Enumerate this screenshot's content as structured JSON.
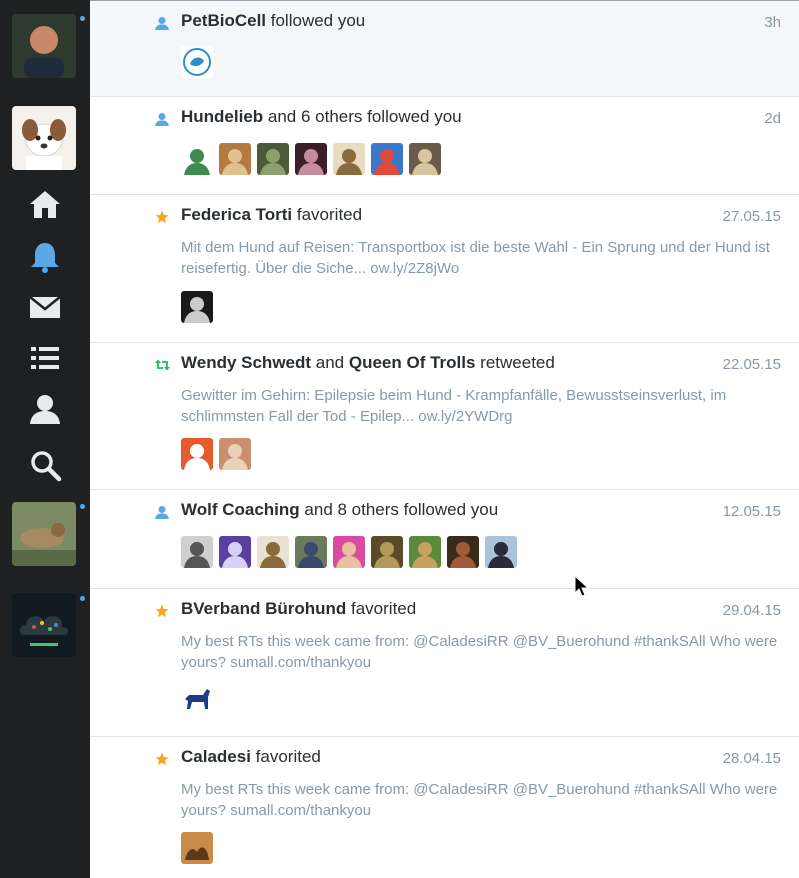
{
  "sidebar": {
    "accounts": [
      {
        "name": "account-avatar-1",
        "colors": [
          "#3b4a3a",
          "#c9876a"
        ]
      },
      {
        "name": "account-avatar-2",
        "colors": [
          "#f2efe9",
          "#8a5a3a"
        ]
      },
      {
        "name": "account-avatar-3",
        "colors": [
          "#6f7d5c",
          "#a58a63"
        ]
      },
      {
        "name": "account-avatar-4",
        "colors": [
          "#0f1a1f",
          "#d94a6c"
        ]
      }
    ],
    "nav": [
      "home-icon",
      "notifications-bell-icon",
      "messages-envelope-icon",
      "lists-icon",
      "profile-icon",
      "search-icon"
    ],
    "active_nav": "notifications-bell-icon",
    "accent": "#5aa7e6"
  },
  "notifications": [
    {
      "type": "follow",
      "actor": "PetBioCell",
      "action": " followed you",
      "time": "3h",
      "avatars": [
        {
          "bg": "#ffffff",
          "fg": "#2d8fc9"
        }
      ]
    },
    {
      "type": "follow",
      "actor": "Hundelieb",
      "action": " and 6 others followed you",
      "time": "2d",
      "avatars": [
        {
          "bg": "#ffffff",
          "fg": "#3f8a50"
        },
        {
          "bg": "#b47a3f",
          "fg": "#e2c08d"
        },
        {
          "bg": "#4a5a3a",
          "fg": "#8ba06a"
        },
        {
          "bg": "#3a1f2a",
          "fg": "#c58ca0"
        },
        {
          "bg": "#e7dbc0",
          "fg": "#8a6a3a"
        },
        {
          "bg": "#3c77c9",
          "fg": "#e04a3a"
        },
        {
          "bg": "#6a5a4a",
          "fg": "#d9c4a0"
        }
      ]
    },
    {
      "type": "favorite",
      "actor": "Federica Torti",
      "action": " favorited",
      "time": "27.05.15",
      "text": "Mit dem Hund auf Reisen: Transportbox ist die beste Wahl - Ein Sprung und der Hund ist reisefertig. Über die Siche... ow.ly/2Z8jWo",
      "avatars": [
        {
          "bg": "#1a1a1a",
          "fg": "#cccccc"
        }
      ]
    },
    {
      "type": "retweet",
      "actor": "Wendy Schwedt",
      "connector": " and ",
      "actor2": "Queen Of Trolls",
      "action": " retweeted",
      "time": "22.05.15",
      "text": "Gewitter im Gehirn: Epilepsie beim Hund - Krampfanfälle, Bewusstseinsverlust, im schlimmsten Fall der Tod - Epilep... ow.ly/2YWDrg",
      "avatars": [
        {
          "bg": "#e55b2e",
          "fg": "#ffffff"
        },
        {
          "bg": "#c99070",
          "fg": "#e9d2b8"
        }
      ]
    },
    {
      "type": "follow",
      "actor": "Wolf Coaching",
      "action": " and 8 others followed you",
      "time": "12.05.15",
      "avatars": [
        {
          "bg": "#cfcfcf",
          "fg": "#555555"
        },
        {
          "bg": "#5a3fa3",
          "fg": "#d9d0f5"
        },
        {
          "bg": "#e9e2d0",
          "fg": "#8a6a3a"
        },
        {
          "bg": "#6a7a5a",
          "fg": "#3a4a6a"
        },
        {
          "bg": "#d94aa0",
          "fg": "#e9c0a0"
        },
        {
          "bg": "#5a4a2a",
          "fg": "#b39a5a"
        },
        {
          "bg": "#5a8a3a",
          "fg": "#c9a060"
        },
        {
          "bg": "#3a2a1a",
          "fg": "#a05a3a"
        },
        {
          "bg": "#a9c4d9",
          "fg": "#2a2a3a"
        }
      ]
    },
    {
      "type": "favorite",
      "actor": "BVerband Bürohund",
      "action": " favorited",
      "time": "29.04.15",
      "text": "My best RTs this week came from: @CaladesiRR @BV_Buerohund #thankSAll Who were yours? sumall.com/thankyou",
      "avatars": [
        {
          "bg": "#ffffff",
          "fg": "#1f3a8a"
        }
      ]
    },
    {
      "type": "favorite",
      "actor": "Caladesi",
      "action": " favorited",
      "time": "28.04.15",
      "text": "My best RTs this week came from: @CaladesiRR @BV_Buerohund #thankSAll Who were yours? sumall.com/thankyou",
      "avatars": [
        {
          "bg": "#c98a4a",
          "fg": "#5a3a1a"
        }
      ]
    }
  ],
  "colors": {
    "follow": "#5aa7e6",
    "favorite": "#f5a623",
    "retweet": "#17bf63"
  }
}
